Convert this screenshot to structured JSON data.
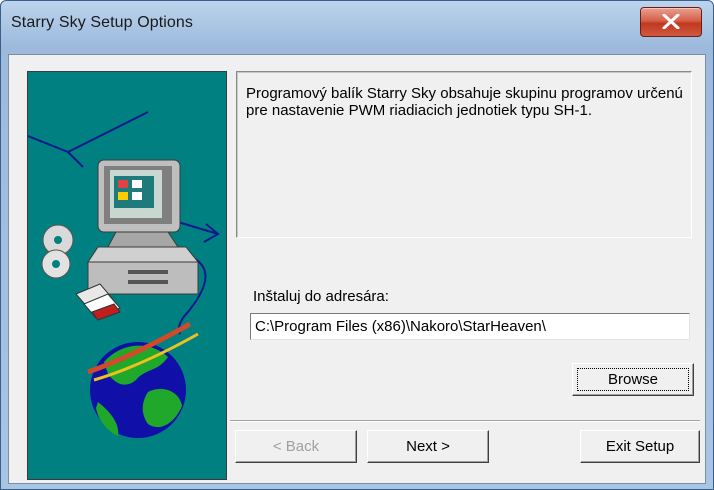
{
  "window": {
    "title": "Starry Sky Setup Options",
    "close_icon": "close-icon"
  },
  "description": "Programový balík Starry Sky obsahuje skupinu programov určenú pre nastavenie PWM riadiacich jednotiek typu SH-1.",
  "install": {
    "label": "Inštaluj do adresára:",
    "path": "C:\\Program Files (x86)\\Nakoro\\StarHeaven\\"
  },
  "buttons": {
    "browse": "Browse",
    "back": "< Back",
    "back_enabled": false,
    "next": "Next >",
    "exit": "Exit Setup"
  },
  "colors": {
    "art_background": "#008080",
    "close_button": "#c2381f"
  }
}
